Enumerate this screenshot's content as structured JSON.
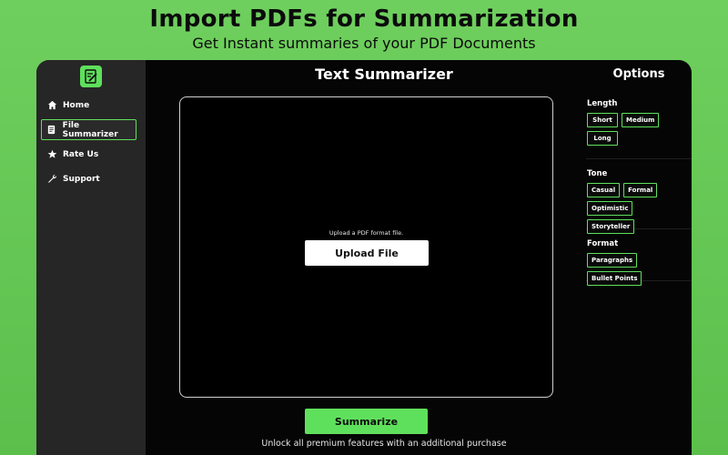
{
  "hero": {
    "title": "Import PDFs for Summarization",
    "subtitle": "Get Instant summaries of your PDF Documents"
  },
  "sidebar": {
    "items": [
      {
        "label": "Home",
        "icon": "home-icon"
      },
      {
        "label": "File Summarizer",
        "icon": "document-icon",
        "active": true
      },
      {
        "label": "Rate Us",
        "icon": "star-icon"
      },
      {
        "label": "Support",
        "icon": "wrench-icon"
      }
    ]
  },
  "main": {
    "title": "Text Summarizer",
    "upload_hint": "Upload a PDF format file.",
    "upload_label": "Upload File",
    "summarize_label": "Summarize",
    "premium_note": "Unlock all premium features with an additional purchase"
  },
  "options": {
    "title": "Options",
    "length": {
      "label": "Length",
      "chips": [
        "Short",
        "Medium",
        "Long"
      ]
    },
    "tone": {
      "label": "Tone",
      "chips": [
        "Casual",
        "Formal",
        "Optimistic",
        "Storyteller"
      ]
    },
    "format": {
      "label": "Format",
      "chips": [
        "Paragraphs",
        "Bullet Points"
      ]
    }
  },
  "colors": {
    "accent": "#5fe05c",
    "background": "#6fcf5e",
    "window": "#050505",
    "sidebar": "#262626"
  }
}
